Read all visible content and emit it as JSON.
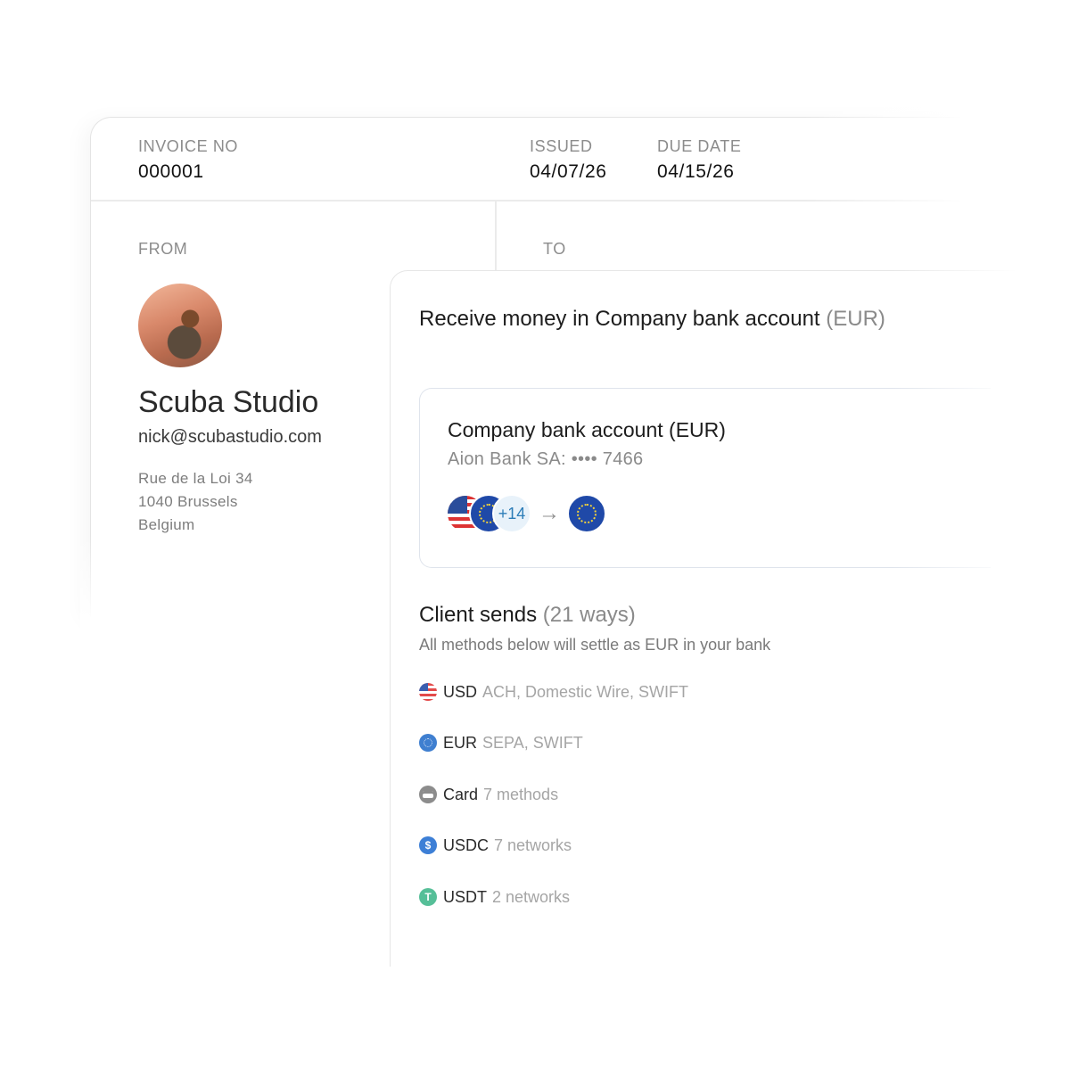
{
  "invoice": {
    "invoice_no_label": "INVOICE NO",
    "invoice_no": "000001",
    "issued_label": "ISSUED",
    "issued": "04/07/26",
    "due_label": "DUE DATE",
    "due": "04/15/26",
    "from_label": "FROM",
    "to_label": "TO"
  },
  "from": {
    "avatar_icon": "avatar-photo",
    "company": "Scuba Studio",
    "email": "nick@scubastudio.com",
    "address_line1": "Rue de la Loi 34",
    "address_line2": "1040 Brussels",
    "address_line3": "Belgium"
  },
  "receive": {
    "title": "Receive money in Company bank account",
    "title_currency": "(EUR)",
    "bank_card": {
      "name": "Company bank account (EUR)",
      "subtitle": "Aion Bank SA: •••• 7466",
      "more_count": "+14",
      "arrow": "→",
      "source_flags": [
        "us-flag-icon",
        "eu-flag-icon"
      ],
      "target_flag": "eu-flag-icon"
    },
    "client_title": "Client sends",
    "client_count": "(21 ways)",
    "client_subtitle": "All methods below will settle as EUR in your bank",
    "methods": [
      {
        "icon": "us-flag-icon",
        "name": "USD",
        "detail": "ACH, Domestic Wire, SWIFT"
      },
      {
        "icon": "eu-flag-icon",
        "name": "EUR",
        "detail": "SEPA, SWIFT"
      },
      {
        "icon": "card-icon",
        "name": "Card",
        "detail": "7 methods"
      },
      {
        "icon": "usdc-icon",
        "name": "USDC",
        "detail": "7 networks"
      },
      {
        "icon": "usdt-icon",
        "name": "USDT",
        "detail": "2 networks"
      }
    ]
  }
}
